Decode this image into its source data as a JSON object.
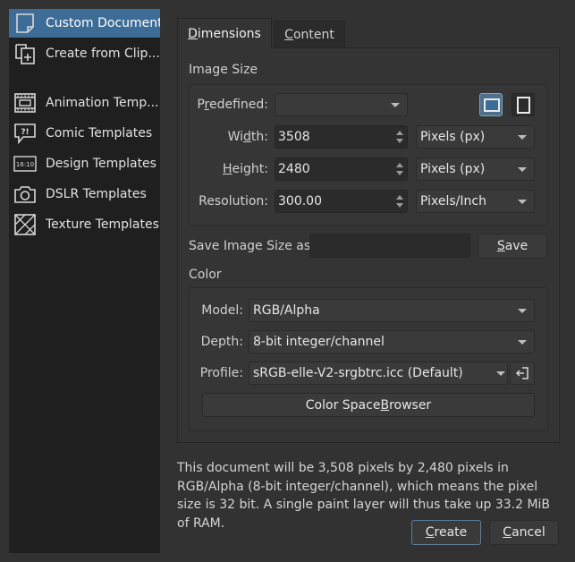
{
  "sidebar": {
    "items": [
      {
        "label": "Custom Document",
        "icon": "custom-document-icon",
        "active": true
      },
      {
        "label": "Create from Clip...",
        "icon": "clipboard-document-icon",
        "active": false
      },
      {
        "label": "Animation Temp...",
        "icon": "animation-template-icon",
        "active": false
      },
      {
        "label": "Comic Templates",
        "icon": "comic-balloon-icon",
        "active": false
      },
      {
        "label": "Design Templates",
        "icon": "design-16-10-icon",
        "active": false
      },
      {
        "label": "DSLR Templates",
        "icon": "camera-icon",
        "active": false
      },
      {
        "label": "Texture Templates",
        "icon": "texture-icon",
        "active": false
      }
    ],
    "design_icon_text": "16:10"
  },
  "tabs": {
    "dimensions": {
      "prefix": "",
      "mnemonic": "D",
      "rest": "imensions"
    },
    "content": {
      "prefix": "",
      "mnemonic": "C",
      "rest": "ontent"
    }
  },
  "image_size": {
    "title": "Image Size",
    "predefined": {
      "prefix": "P",
      "mnemonic": "r",
      "rest": "edefined:",
      "value": ""
    },
    "width": {
      "prefix": "Wi",
      "mnemonic": "d",
      "rest": "th:",
      "value": "3508",
      "unit": "Pixels (px)"
    },
    "height": {
      "prefix": "",
      "mnemonic": "H",
      "rest": "eight:",
      "value": "2480",
      "unit": "Pixels (px)"
    },
    "resolution": {
      "label": "Resolution:",
      "value": "300.00",
      "unit": "Pixels/Inch"
    },
    "orientation": {
      "landscape_icon": "landscape-orientation-icon",
      "portrait_icon": "portrait-orientation-icon",
      "selected": "landscape"
    }
  },
  "save_size": {
    "label": "Save Image Size as:",
    "value": "",
    "button": {
      "prefix": "",
      "mnemonic": "S",
      "rest": "ave"
    }
  },
  "color": {
    "title": "Color",
    "model": {
      "label": "Model:",
      "value": "RGB/Alpha"
    },
    "depth": {
      "label": "Depth:",
      "value": "8-bit integer/channel"
    },
    "profile": {
      "label": "Profile:",
      "value": "sRGB-elle-V2-srgbtrc.icc (Default)",
      "button_icon": "import-profile-icon"
    },
    "browser_button": {
      "prefix": "Color Space ",
      "mnemonic": "B",
      "rest": "rowser"
    }
  },
  "info_text": "This document will be 3,508 pixels by 2,480 pixels in RGB/Alpha (8-bit integer/channel), which means the pixel size is 32 bit. A single paint layer will thus take up 33.2 MiB of RAM.",
  "actions": {
    "create": {
      "prefix": "",
      "mnemonic": "C",
      "rest": "reate"
    },
    "cancel": {
      "prefix": "",
      "mnemonic": "C",
      "rest": "ancel"
    }
  },
  "colors": {
    "background": "#323232",
    "sidebar": "#1f1f1f",
    "active_item": "#3d6d97",
    "field": "#2b2b2b"
  }
}
